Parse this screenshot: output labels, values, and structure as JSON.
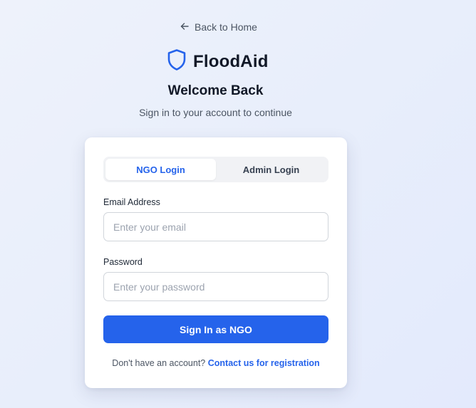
{
  "nav": {
    "back_label": "Back to Home"
  },
  "brand": {
    "name": "FloodAid",
    "accent": "#2563eb"
  },
  "header": {
    "title": "Welcome Back",
    "subtitle": "Sign in to your account to continue"
  },
  "tabs": [
    {
      "label": "NGO Login",
      "active": true
    },
    {
      "label": "Admin Login",
      "active": false
    }
  ],
  "form": {
    "email": {
      "label": "Email Address",
      "value": "",
      "placeholder": "Enter your email"
    },
    "password": {
      "label": "Password",
      "value": "",
      "placeholder": "Enter your password"
    },
    "submit_label": "Sign In as NGO"
  },
  "footer": {
    "prompt": "Don't have an account?",
    "link_label": "Contact us for registration"
  },
  "icons": {
    "back": "arrow-left-icon",
    "brand": "shield-icon"
  }
}
